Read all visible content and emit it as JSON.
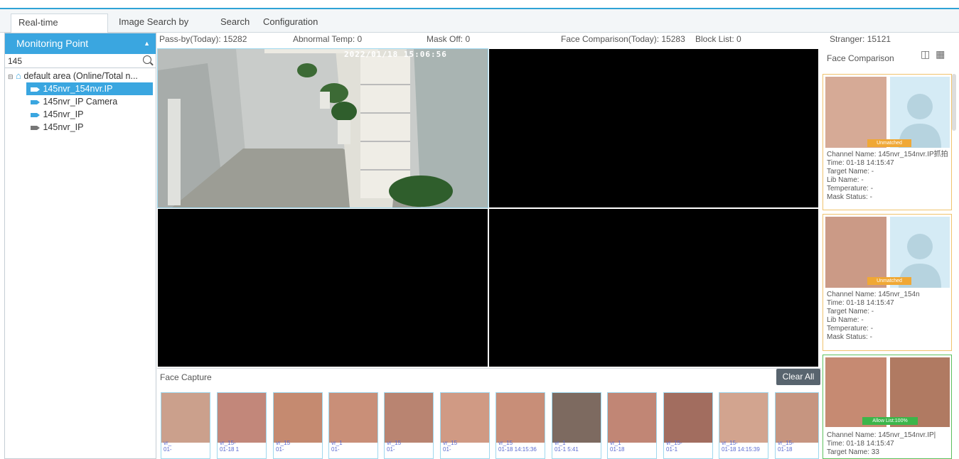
{
  "tabs": [
    "Real-time Monitoring",
    "Image Search by Face",
    "Search",
    "Configuration"
  ],
  "left_panel": {
    "title": "Monitoring Point",
    "search_value": "145",
    "tree": {
      "root_label": "default area (Online/Total n...",
      "channels": [
        "145nvr_154nvr.IP",
        "145nvr_IP Camera",
        "145nvr_IP",
        "145nvr_IP"
      ]
    }
  },
  "stats": {
    "pass_by": "Pass-by(Today): 15282",
    "abnormal_temp": "Abnormal Temp: 0",
    "mask_off": "Mask Off: 0",
    "face_comparison": "Face Comparison(Today): 15283",
    "block_list": "Block List: 0",
    "stranger": "Stranger: 15121"
  },
  "video": {
    "timestamp": "2022/01/18 15:06:56"
  },
  "capture": {
    "label": "Face Capture",
    "clear_label": "Clear All",
    "thumbs": [
      {
        "l1": "vr_",
        "l2": "01-"
      },
      {
        "l1": "vr_15-",
        "l2": "01-18 1"
      },
      {
        "l1": "vr_15",
        "l2": "01-"
      },
      {
        "l1": "vr_1",
        "l2": "01-"
      },
      {
        "l1": "vr_15",
        "l2": "01-"
      },
      {
        "l1": "vr_15",
        "l2": "01-"
      },
      {
        "l1": "vr_15",
        "l2": "01-18 14:15:36"
      },
      {
        "l1": "vr_1",
        "l2": "01-1 5:41"
      },
      {
        "l1": "vr_1",
        "l2": "01-18"
      },
      {
        "l1": "vr_15-",
        "l2": "01-1"
      },
      {
        "l1": "vr_15-",
        "l2": "01-18 14:15:39"
      },
      {
        "l1": "vr_15-",
        "l2": "01-18"
      }
    ]
  },
  "right_panel": {
    "title": "Face Comparison",
    "cards": [
      {
        "badge": "Unmatched",
        "channel": "Channel Name: 145nvr_154nvr.IP抓拍",
        "time": "Time: 01-18 14:15:47",
        "target": "Target Name: -",
        "lib": "Lib Name: -",
        "temp": "Temperature: -",
        "mask": "Mask Status: -"
      },
      {
        "badge": "Unmatched",
        "channel": "Channel Name: 145nvr_154n",
        "time": "Time: 01-18 14:15:47",
        "target": "Target Name: -",
        "lib": "Lib Name: -",
        "temp": "Temperature: -",
        "mask": "Mask Status: -"
      },
      {
        "badge": "Allow List:100%",
        "channel": "Channel Name: 145nvr_154nvr.IP|",
        "time": "Time: 01-18 14:15:47",
        "target": "Target Name: 33"
      }
    ]
  }
}
